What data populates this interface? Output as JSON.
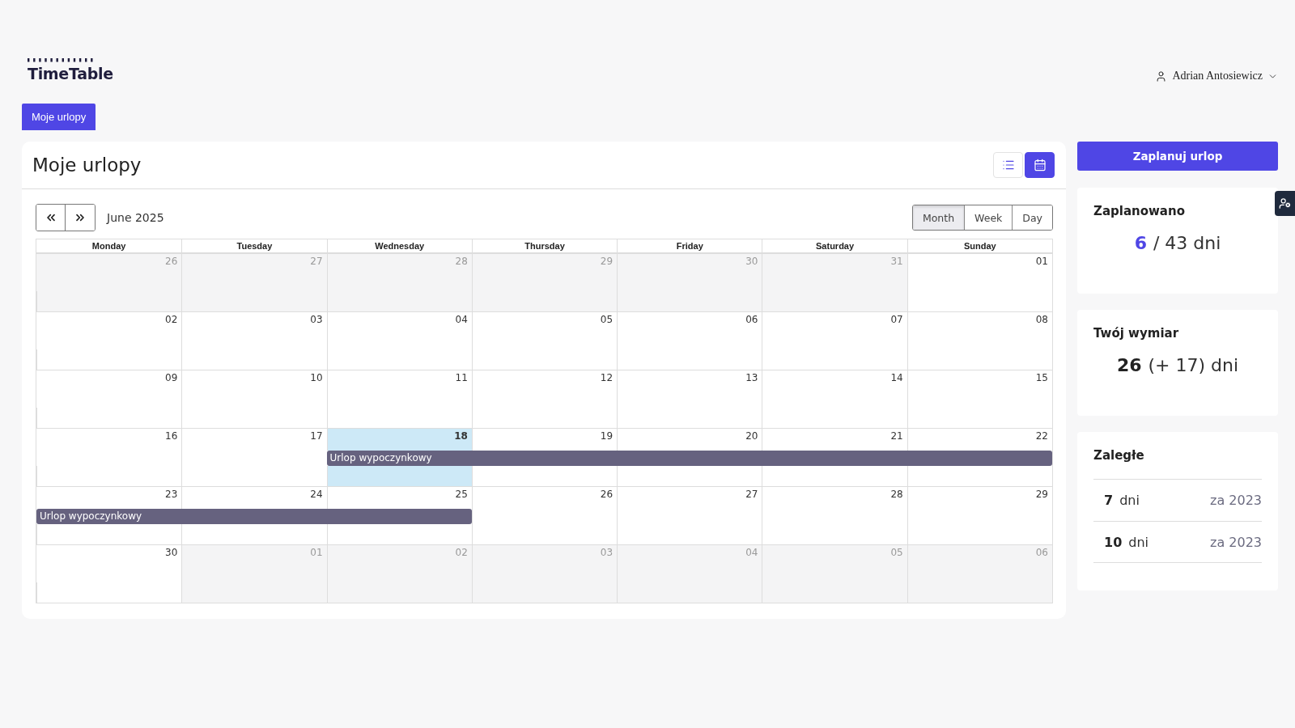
{
  "logo": {
    "text": "TimeTable"
  },
  "user": {
    "name": "Adrian Antosiewicz"
  },
  "nav": [
    {
      "label": "Moje urlopy",
      "selected": true
    }
  ],
  "main": {
    "title": "Moje urlopy",
    "views": [
      {
        "kind": "list",
        "selected": false
      },
      {
        "kind": "calendar",
        "selected": true
      }
    ],
    "toolbar": {
      "period": "June 2025",
      "ranges": [
        {
          "label": "Month",
          "selected": true
        },
        {
          "label": "Week",
          "selected": false
        },
        {
          "label": "Day",
          "selected": false
        }
      ]
    },
    "weekdays": [
      "Monday",
      "Tuesday",
      "Wednesday",
      "Thursday",
      "Friday",
      "Saturday",
      "Sunday"
    ],
    "weeks": [
      {
        "days": [
          {
            "day": "26",
            "other_month": true,
            "today": false,
            "in_event": false
          },
          {
            "day": "27",
            "other_month": true,
            "today": false,
            "in_event": false
          },
          {
            "day": "28",
            "other_month": true,
            "today": false,
            "in_event": false
          },
          {
            "day": "29",
            "other_month": true,
            "today": false,
            "in_event": false
          },
          {
            "day": "30",
            "other_month": true,
            "today": false,
            "in_event": false
          },
          {
            "day": "31",
            "other_month": true,
            "today": false,
            "in_event": false
          },
          {
            "day": "01",
            "other_month": false,
            "today": false,
            "in_event": false
          }
        ]
      },
      {
        "days": [
          {
            "day": "02",
            "other_month": false,
            "today": false,
            "in_event": false
          },
          {
            "day": "03",
            "other_month": false,
            "today": false,
            "in_event": false
          },
          {
            "day": "04",
            "other_month": false,
            "today": false,
            "in_event": false
          },
          {
            "day": "05",
            "other_month": false,
            "today": false,
            "in_event": false
          },
          {
            "day": "06",
            "other_month": false,
            "today": false,
            "in_event": false
          },
          {
            "day": "07",
            "other_month": false,
            "today": false,
            "in_event": false
          },
          {
            "day": "08",
            "other_month": false,
            "today": false,
            "in_event": false
          }
        ]
      },
      {
        "days": [
          {
            "day": "09",
            "other_month": false,
            "today": false,
            "in_event": false
          },
          {
            "day": "10",
            "other_month": false,
            "today": false,
            "in_event": false
          },
          {
            "day": "11",
            "other_month": false,
            "today": false,
            "in_event": false
          },
          {
            "day": "12",
            "other_month": false,
            "today": false,
            "in_event": false
          },
          {
            "day": "13",
            "other_month": false,
            "today": false,
            "in_event": false
          },
          {
            "day": "14",
            "other_month": false,
            "today": false,
            "in_event": false
          },
          {
            "day": "15",
            "other_month": false,
            "today": false,
            "in_event": false
          }
        ]
      },
      {
        "days": [
          {
            "day": "16",
            "other_month": false,
            "today": false,
            "in_event": false
          },
          {
            "day": "17",
            "other_month": false,
            "today": false,
            "in_event": false
          },
          {
            "day": "18",
            "other_month": false,
            "today": true,
            "in_event": true,
            "event": "Urlop wypoczynkowy"
          },
          {
            "day": "19",
            "other_month": false,
            "today": false,
            "in_event": true
          },
          {
            "day": "20",
            "other_month": false,
            "today": false,
            "in_event": true
          },
          {
            "day": "21",
            "other_month": false,
            "today": false,
            "in_event": true
          },
          {
            "day": "22",
            "other_month": false,
            "today": false,
            "in_event": true
          }
        ]
      },
      {
        "days": [
          {
            "day": "23",
            "other_month": false,
            "today": false,
            "in_event": true,
            "event": "Urlop wypoczynkowy"
          },
          {
            "day": "24",
            "other_month": false,
            "today": false,
            "in_event": true
          },
          {
            "day": "25",
            "other_month": false,
            "today": false,
            "in_event": true
          },
          {
            "day": "26",
            "other_month": false,
            "today": false,
            "in_event": false
          },
          {
            "day": "27",
            "other_month": false,
            "today": false,
            "in_event": false
          },
          {
            "day": "28",
            "other_month": false,
            "today": false,
            "in_event": false
          },
          {
            "day": "29",
            "other_month": false,
            "today": false,
            "in_event": false
          }
        ]
      },
      {
        "days": [
          {
            "day": "30",
            "other_month": false,
            "today": false,
            "in_event": false
          },
          {
            "day": "01",
            "other_month": true,
            "today": false,
            "in_event": false
          },
          {
            "day": "02",
            "other_month": true,
            "today": false,
            "in_event": false
          },
          {
            "day": "03",
            "other_month": true,
            "today": false,
            "in_event": false
          },
          {
            "day": "04",
            "other_month": true,
            "today": false,
            "in_event": false
          },
          {
            "day": "05",
            "other_month": true,
            "today": false,
            "in_event": false
          },
          {
            "day": "06",
            "other_month": true,
            "today": false,
            "in_event": false
          }
        ]
      }
    ]
  },
  "plan_button": "Zaplanuj urlop",
  "planned": {
    "title": "Zaplanowano",
    "used": "6",
    "total": "/ 43 dni"
  },
  "allowance": {
    "title": "Twój wymiar",
    "days": "26",
    "extra": "(+ 17) dni"
  },
  "overdue": {
    "title": "Zaległe",
    "rows": [
      {
        "amount": "7",
        "unit": "dni",
        "year": "za 2023"
      },
      {
        "amount": "10",
        "unit": "dni",
        "year": "za 2023"
      }
    ]
  }
}
